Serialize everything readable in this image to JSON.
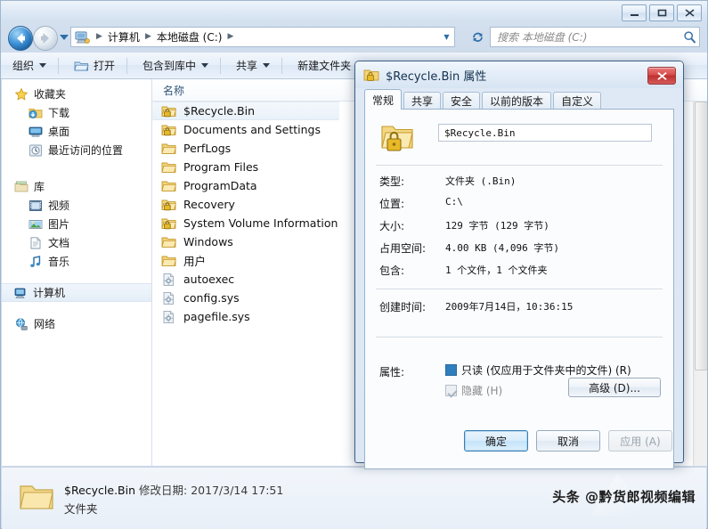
{
  "window": {
    "controls": {
      "minimize": "minimize-button",
      "maximize": "maximize-button",
      "close": "close-button"
    }
  },
  "address": {
    "breadcrumb": [
      "计算机",
      "本地磁盘 (C:)"
    ],
    "separator": "▶"
  },
  "search": {
    "placeholder": "搜索 本地磁盘 (C:)"
  },
  "toolbar": {
    "items": [
      {
        "label": "组织",
        "caret": true,
        "icon": null
      },
      {
        "label": "打开",
        "caret": false,
        "icon": "open-folder-icon"
      },
      {
        "label": "包含到库中",
        "caret": true,
        "icon": null
      },
      {
        "label": "共享",
        "caret": true,
        "icon": null
      },
      {
        "label": "新建文件夹",
        "caret": false,
        "icon": null
      }
    ]
  },
  "sidebar": {
    "groups": [
      {
        "header": {
          "label": "收藏夹",
          "icon": "star-icon"
        },
        "items": [
          {
            "label": "下载",
            "icon": "download-folder-icon"
          },
          {
            "label": "桌面",
            "icon": "desktop-icon"
          },
          {
            "label": "最近访问的位置",
            "icon": "recent-places-icon"
          }
        ]
      },
      {
        "header": {
          "label": "库",
          "icon": "library-icon"
        },
        "items": [
          {
            "label": "视频",
            "icon": "video-library-icon"
          },
          {
            "label": "图片",
            "icon": "pictures-library-icon"
          },
          {
            "label": "文档",
            "icon": "documents-library-icon"
          },
          {
            "label": "音乐",
            "icon": "music-library-icon"
          }
        ]
      }
    ],
    "computer": {
      "label": "计算机",
      "icon": "computer-icon",
      "selected": true
    },
    "network": {
      "label": "网络",
      "icon": "network-icon"
    }
  },
  "filelist": {
    "column_header": "名称",
    "rows": [
      {
        "name": "$Recycle.Bin",
        "icon": "locked-folder-icon",
        "selected": true
      },
      {
        "name": "Documents and Settings",
        "icon": "locked-folder-icon",
        "selected": false
      },
      {
        "name": "PerfLogs",
        "icon": "folder-icon",
        "selected": false
      },
      {
        "name": "Program Files",
        "icon": "folder-icon",
        "selected": false
      },
      {
        "name": "ProgramData",
        "icon": "folder-icon",
        "selected": false
      },
      {
        "name": "Recovery",
        "icon": "locked-folder-icon",
        "selected": false
      },
      {
        "name": "System Volume Information",
        "icon": "locked-folder-icon",
        "selected": false
      },
      {
        "name": "Windows",
        "icon": "folder-icon",
        "selected": false
      },
      {
        "name": "用户",
        "icon": "folder-icon",
        "selected": false
      },
      {
        "name": "autoexec",
        "icon": "system-file-icon",
        "selected": false
      },
      {
        "name": "config.sys",
        "icon": "system-file-icon",
        "selected": false
      },
      {
        "name": "pagefile.sys",
        "icon": "system-file-icon",
        "selected": false
      }
    ]
  },
  "details": {
    "name": "$Recycle.Bin",
    "modified_label": "修改日期:",
    "modified_value": "2017/3/14 17:51",
    "type": "文件夹",
    "watermark": "头条 @黔货郎视频编辑"
  },
  "dialog": {
    "title": "$Recycle.Bin 属性",
    "close_label": "✕",
    "tabs": [
      {
        "label": "常规",
        "active": true
      },
      {
        "label": "共享",
        "active": false
      },
      {
        "label": "安全",
        "active": false
      },
      {
        "label": "以前的版本",
        "active": false
      },
      {
        "label": "自定义",
        "active": false
      }
    ],
    "name_value": "$Recycle.Bin",
    "rows": [
      {
        "label": "类型:",
        "value": "文件夹 (.Bin)"
      },
      {
        "label": "位置:",
        "value": "C:\\"
      },
      {
        "label": "大小:",
        "value": "129 字节 (129 字节)"
      },
      {
        "label": "占用空间:",
        "value": "4.00 KB (4,096 字节)"
      },
      {
        "label": "包含:",
        "value": "1 个文件，1 个文件夹"
      }
    ],
    "created": {
      "label": "创建时间:",
      "value": "2009年7月14日，10:36:15"
    },
    "attributes": {
      "label": "属性:",
      "readonly": "只读 (仅应用于文件夹中的文件) (R)",
      "hidden": "隐藏 (H)",
      "advanced_button": "高级 (D)..."
    },
    "buttons": {
      "ok": "确定",
      "cancel": "取消",
      "apply": "应用 (A)"
    }
  },
  "colors": {
    "accent": "#3c7fb1",
    "dialog_border": "#3b5e85",
    "close_red": "#d64b4b",
    "folder_yellow": "#f5c65a",
    "lock_gold": "#d8a21e"
  }
}
